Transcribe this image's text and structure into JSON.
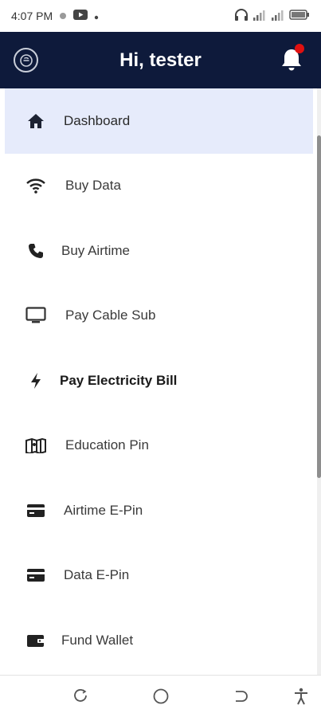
{
  "status_bar": {
    "time": "4:07 PM",
    "icons": [
      "dot-icon",
      "youtube-icon",
      "dot-small-icon",
      "headphones-icon",
      "signal-icon",
      "signal-icon",
      "battery-icon"
    ]
  },
  "header": {
    "greeting": "Hi, tester",
    "logo_icon": "app-logo-icon",
    "bell_icon": "bell-icon",
    "notification_color": "#e01010",
    "background_color": "#0e1a3b"
  },
  "menu": {
    "active_background": "#e6ebfb",
    "items": [
      {
        "label": "Dashboard",
        "icon": "home-icon"
      },
      {
        "label": "Buy Data",
        "icon": "wifi-icon"
      },
      {
        "label": "Buy Airtime",
        "icon": "phone-icon"
      },
      {
        "label": "Pay Cable Sub",
        "icon": "monitor-icon"
      },
      {
        "label": "Pay Electricity Bill",
        "icon": "bolt-icon"
      },
      {
        "label": "Education Pin",
        "icon": "map-icon"
      },
      {
        "label": "Airtime E-Pin",
        "icon": "card-icon"
      },
      {
        "label": "Data E-Pin",
        "icon": "card-icon"
      },
      {
        "label": "Fund Wallet",
        "icon": "wallet-icon"
      }
    ]
  },
  "nav_bar": {
    "buttons": [
      "recents-icon",
      "home-circle-icon",
      "back-icon",
      "accessibility-icon"
    ]
  }
}
